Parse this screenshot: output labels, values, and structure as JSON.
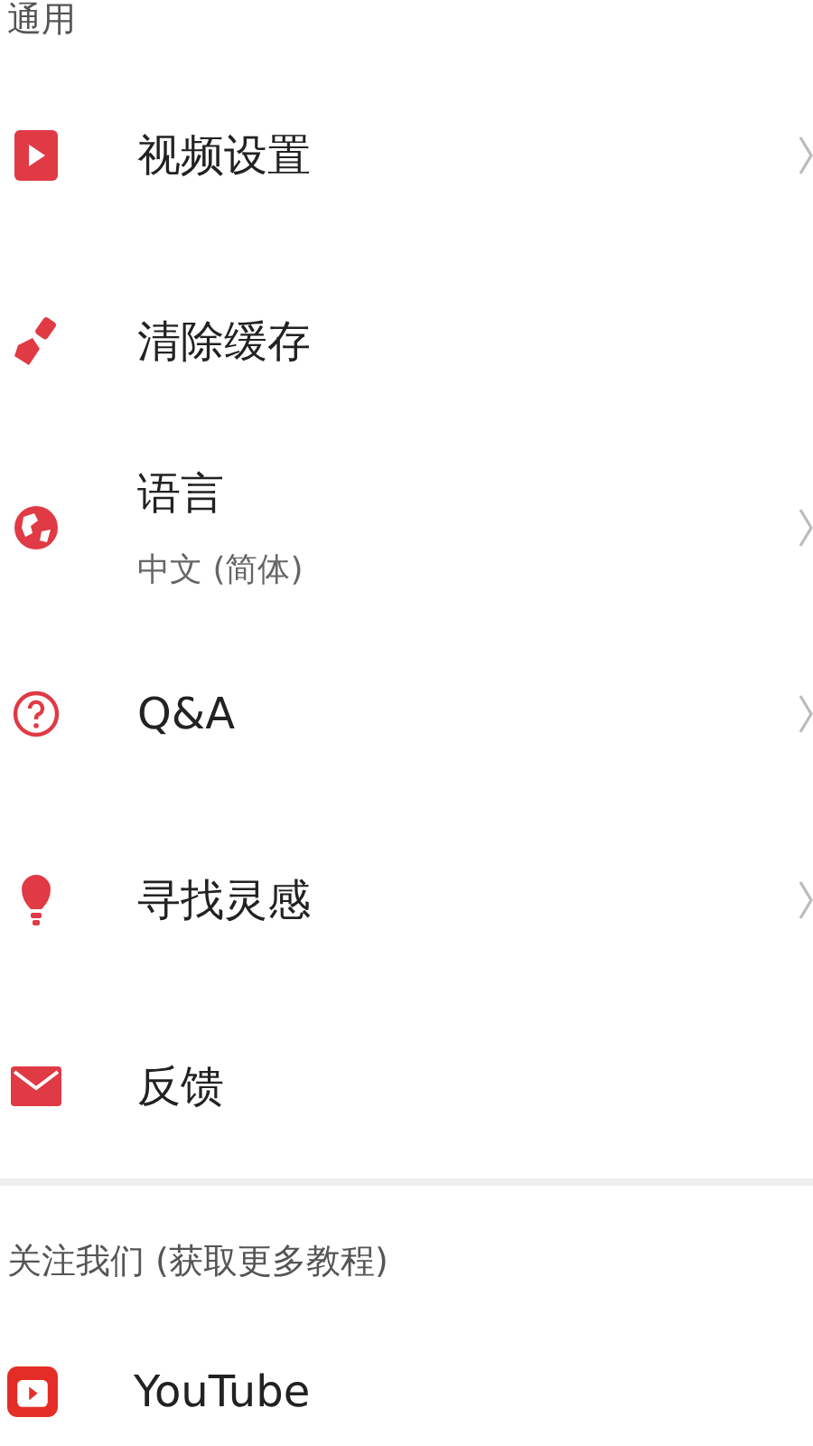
{
  "section_general": {
    "title": "通用"
  },
  "items": [
    {
      "kind": "video",
      "label": "视频设置",
      "arrow": true
    },
    {
      "kind": "brush",
      "label": "清除缓存",
      "arrow": false
    },
    {
      "kind": "globe",
      "label": "语言",
      "subtitle": "中文 (简体)",
      "arrow": true
    },
    {
      "kind": "question",
      "label": "Q&A",
      "arrow": true
    },
    {
      "kind": "bulb",
      "label": "寻找灵感",
      "arrow": true
    },
    {
      "kind": "mail",
      "label": "反馈",
      "arrow": false
    }
  ],
  "section_follow": {
    "title": "关注我们 (获取更多教程)"
  },
  "follow_items": [
    {
      "kind": "youtube",
      "label": "YouTube"
    }
  ]
}
